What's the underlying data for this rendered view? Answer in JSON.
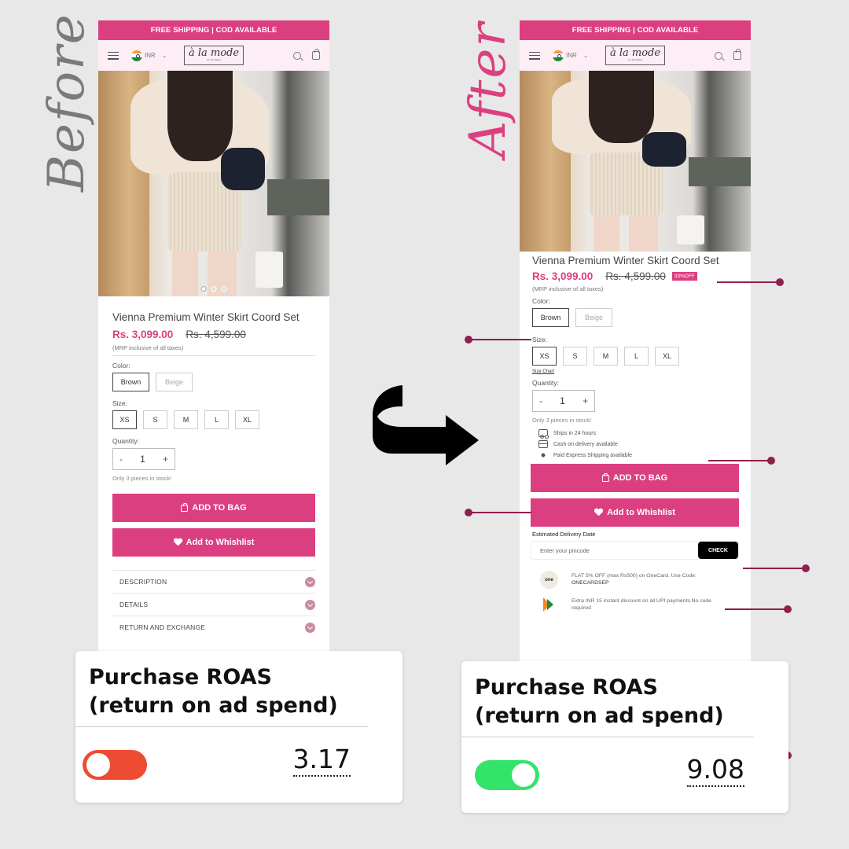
{
  "labels": {
    "before": "Before",
    "after": "After"
  },
  "store": {
    "promo_banner": "FREE SHIPPING | COD AVAILABLE",
    "currency": "INR",
    "logo_text": "à la mode",
    "logo_subtext": "by Morakhe"
  },
  "product": {
    "title": "Vienna Premium Winter Skirt Coord Set",
    "price": "Rs. 3,099.00",
    "mrp": "Rs. 4,599.00",
    "discount_badge": "33%OFF",
    "tax_note": "(MRP inclusive of all taxes)",
    "color_label": "Color:",
    "colors": [
      "Brown",
      "Beige"
    ],
    "selected_color": "Brown",
    "size_label": "Size:",
    "sizes": [
      "XS",
      "S",
      "M",
      "L",
      "XL"
    ],
    "selected_size": "XS",
    "size_chart_link": "Size Chart",
    "quantity_label": "Quantity:",
    "quantity_value": "1",
    "qty_minus": "-",
    "qty_plus": "+",
    "stock_note": "Only 3 pieces in stock!",
    "image_slides": 3,
    "active_slide": 1
  },
  "features": [
    {
      "icon": "truck-icon",
      "text": "Ships in 24 hours"
    },
    {
      "icon": "credit-card-icon",
      "text": "Cash on delivery available"
    },
    {
      "icon": "rocket-icon",
      "text": "Paid Express Shipping available"
    }
  ],
  "buttons": {
    "add_to_bag": "ADD TO BAG",
    "add_to_wishlist": "Add to Whishlist",
    "check": "CHECK"
  },
  "accordion": [
    "DESCRIPTION",
    "DETAILS",
    "RETURN AND EXCHANGE"
  ],
  "delivery": {
    "label": "Estimated Delivery Date",
    "pincode_placeholder": "Enter your pincode"
  },
  "offers": [
    {
      "icon": "onecard-logo",
      "logo_text": "one",
      "text": "FLAT 5% OFF  (max Rs500) on OneCard. Use Code:",
      "code": "ONECARDSEP"
    },
    {
      "icon": "upi-logo",
      "text": "Extra INR 15 instant discount on all UPI payments.No code required",
      "code": ""
    }
  ],
  "metrics": {
    "before": {
      "title_line1": "Purchase ROAS",
      "title_line2": "(return on ad spend)",
      "value": "3.17",
      "toggle": "off",
      "toggle_color": "#ee4b33"
    },
    "after": {
      "title_line1": "Purchase ROAS",
      "title_line2": "(return on ad spend)",
      "value": "9.08",
      "toggle": "on",
      "toggle_color": "#34e36a"
    }
  },
  "colors": {
    "brand_pink": "#dc3f80",
    "header_bg": "#fdeef6",
    "connector": "#8e1f4f",
    "page_bg": "#e8e8e8"
  }
}
